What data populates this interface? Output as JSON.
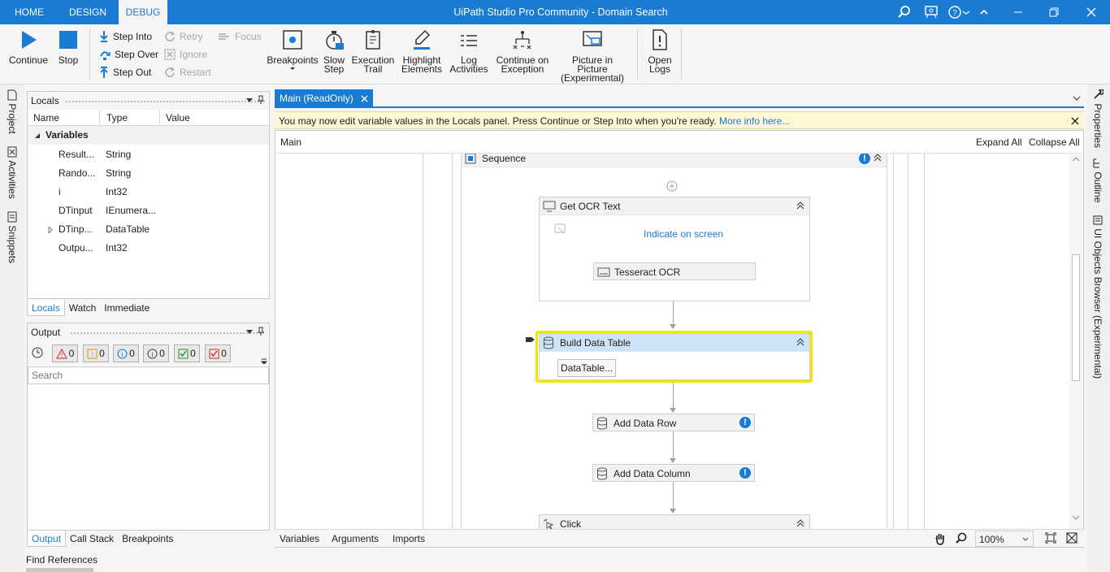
{
  "titlebar": {
    "tabs": [
      "HOME",
      "DESIGN",
      "DEBUG"
    ],
    "title": "UiPath Studio Pro Community - Domain Search"
  },
  "ribbon": {
    "continue": "Continue",
    "stop": "Stop",
    "step_into": "Step Into",
    "step_over": "Step Over",
    "step_out": "Step Out",
    "retry": "Retry",
    "ignore": "Ignore",
    "restart": "Restart",
    "focus": "Focus",
    "breakpoints": "Breakpoints",
    "slow_step_1": "Slow",
    "slow_step_2": "Step",
    "execution_trail_1": "Execution",
    "execution_trail_2": "Trail",
    "highlight_1": "Highlight",
    "highlight_2": "Elements",
    "log_1": "Log",
    "log_2": "Activities",
    "continue_exc_1": "Continue on",
    "continue_exc_2": "Exception",
    "pip_1": "Picture in Picture",
    "pip_2": "(Experimental)",
    "open_logs_1": "Open",
    "open_logs_2": "Logs"
  },
  "leftstrip": {
    "project": "Project",
    "activities": "Activities",
    "snippets": "Snippets"
  },
  "locals": {
    "title": "Locals",
    "columns": [
      "Name",
      "Type",
      "Value"
    ],
    "group": "Variables",
    "rows": [
      {
        "name": "Result...",
        "type": "String"
      },
      {
        "name": "Rando...",
        "type": "String"
      },
      {
        "name": "i",
        "type": "Int32"
      },
      {
        "name": "DTinput",
        "type": "IEnumera..."
      },
      {
        "name": "DTinp...",
        "type": "DataTable"
      },
      {
        "name": "Outpu...",
        "type": "Int32"
      }
    ],
    "tabs": [
      "Locals",
      "Watch",
      "Immediate"
    ]
  },
  "output": {
    "title": "Output",
    "counts": [
      "0",
      "0",
      "0",
      "0",
      "0",
      "0"
    ],
    "search_placeholder": "Search",
    "tabs": [
      "Output",
      "Call Stack",
      "Breakpoints"
    ],
    "find_references": "Find References"
  },
  "document": {
    "tab": "Main (ReadOnly)",
    "info_text": "You may now edit variable values in the Locals panel. Press Continue or Step Into when you're ready.",
    "info_link": "More info here...",
    "breadcrumb": "Main",
    "expand_all": "Expand All",
    "collapse_all": "Collapse All"
  },
  "workflow": {
    "sequence": "Sequence",
    "get_ocr": "Get OCR Text",
    "indicate": "Indicate on screen",
    "tesseract": "Tesseract OCR",
    "build_dt": "Build Data Table",
    "datatable_btn": "DataTable...",
    "add_row": "Add Data Row",
    "add_column": "Add Data Column",
    "click": "Click"
  },
  "statusbar": {
    "variables": "Variables",
    "arguments": "Arguments",
    "imports": "Imports",
    "zoom": "100%"
  },
  "rightstrip": {
    "properties": "Properties",
    "outline": "Outline",
    "ui_objects": "UI Objects Browser (Experimental)"
  },
  "colors": {
    "accent": "#1a7bd2",
    "highlight": "#f0e800",
    "info_bg": "#fff6d5"
  }
}
